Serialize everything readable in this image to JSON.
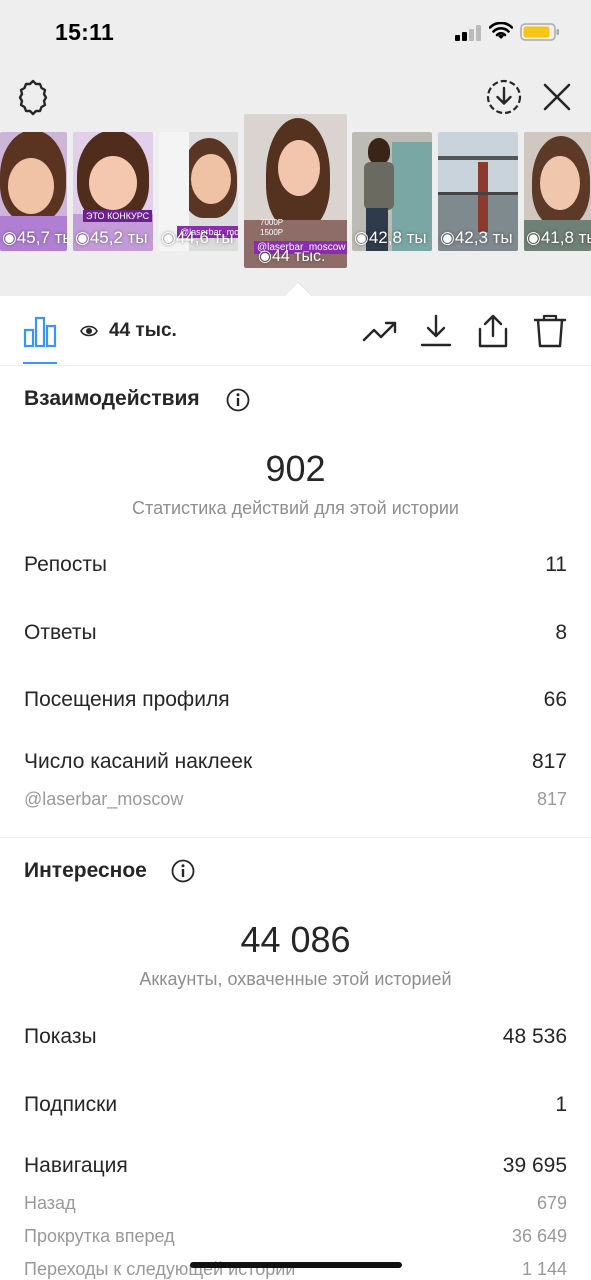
{
  "status_bar": {
    "time": "15:11"
  },
  "stories": [
    {
      "views": "45,7 ты"
    },
    {
      "views": "45,2 ты",
      "sticker": "ЭТО КОНКУРС"
    },
    {
      "views": "44,6 ты",
      "sticker": "@laserbar_moscow"
    },
    {
      "views": "44 тыс.",
      "sticker": "@laserbar_moscow",
      "price_old": "7000Р",
      "price_new": "1500Р",
      "selected": true
    },
    {
      "views": "42,8 ты"
    },
    {
      "views": "42,3 ты"
    },
    {
      "views": "41,8 ты"
    }
  ],
  "tabbar": {
    "views_label": "44 тыс."
  },
  "interactions": {
    "title": "Взаимодействия",
    "total": "902",
    "subtitle": "Статистика действий для этой истории",
    "rows": [
      {
        "label": "Репосты",
        "value": "11"
      },
      {
        "label": "Ответы",
        "value": "8"
      },
      {
        "label": "Посещения профиля",
        "value": "66"
      },
      {
        "label": "Число касаний наклеек",
        "value": "817"
      }
    ],
    "sticker_sub": {
      "label": "@laserbar_moscow",
      "value": "817"
    }
  },
  "discovery": {
    "title": "Интересное",
    "total": "44 086",
    "subtitle": "Аккаунты, охваченные этой историей",
    "rows": [
      {
        "label": "Показы",
        "value": "48 536"
      },
      {
        "label": "Подписки",
        "value": "1"
      },
      {
        "label": "Навигация",
        "value": "39 695"
      }
    ],
    "nav_sub": [
      {
        "label": "Назад",
        "value": "679"
      },
      {
        "label": "Прокрутка вперед",
        "value": "36 649"
      },
      {
        "label": "Переходы к следующей истории",
        "value": "1 144"
      }
    ]
  },
  "colors": {
    "accent": "#3897f0",
    "sticker_purple": "#8a2db0",
    "battery": "#f5c518"
  },
  "icons": [
    "gear-icon",
    "download-circle-icon",
    "close-icon",
    "bar-chart-icon",
    "eye-icon",
    "trending-icon",
    "download-icon",
    "share-icon",
    "trash-icon",
    "info-icon"
  ]
}
